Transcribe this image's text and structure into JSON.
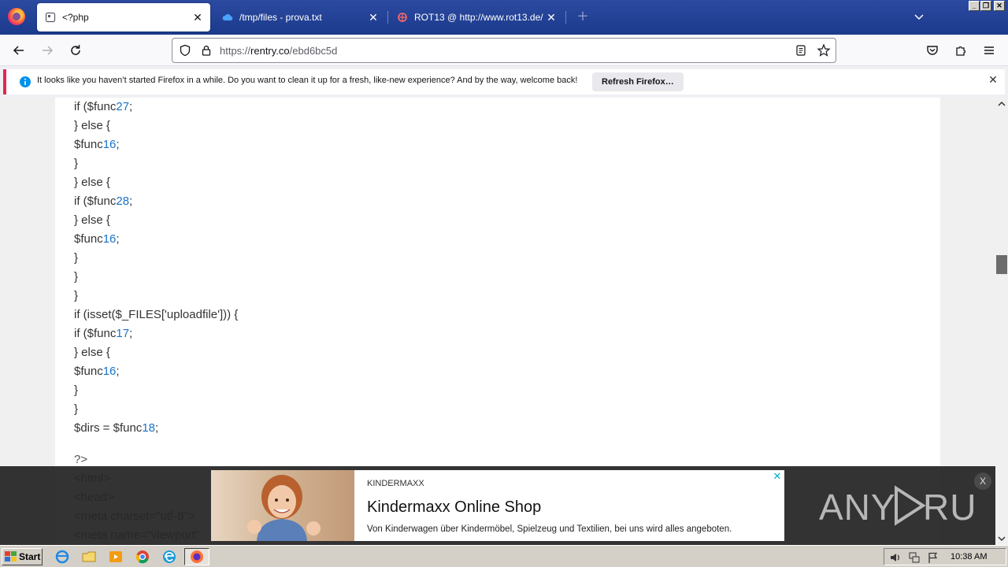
{
  "browser": {
    "tabs": [
      {
        "title": "<?php",
        "active": true,
        "icon": "page-icon"
      },
      {
        "title": "/tmp/files - prova.txt",
        "active": false,
        "icon": "cloud-icon"
      },
      {
        "title": "ROT13 @ http://www.rot13.de/",
        "active": false,
        "icon": "rot13-icon"
      }
    ],
    "url_prefix": "https://",
    "url_host": "rentry.co",
    "url_path": "/ebd6bc5d"
  },
  "notification": {
    "message": "It looks like you haven’t started Firefox in a while. Do you want to clean it up for a fresh, like-new experience? And by the way, welcome back!",
    "button_label": "Refresh Firefox…",
    "close_label": "✕"
  },
  "code_lines": [
    {
      "pre": "if ($func",
      "num": "27",
      "post": ";"
    },
    {
      "pre": "} else {",
      "num": "",
      "post": ""
    },
    {
      "pre": "$func",
      "num": "16",
      "post": ";"
    },
    {
      "pre": "}",
      "num": "",
      "post": ""
    },
    {
      "pre": "} else {",
      "num": "",
      "post": ""
    },
    {
      "pre": "if ($func",
      "num": "28",
      "post": ";"
    },
    {
      "pre": "} else {",
      "num": "",
      "post": ""
    },
    {
      "pre": "$func",
      "num": "16",
      "post": ";"
    },
    {
      "pre": "}",
      "num": "",
      "post": ""
    },
    {
      "pre": "}",
      "num": "",
      "post": ""
    },
    {
      "pre": "}",
      "num": "",
      "post": ""
    },
    {
      "pre": "if (isset($_FILES['uploadfile'])) {",
      "num": "",
      "post": ""
    },
    {
      "pre": "if ($func",
      "num": "17",
      "post": ";"
    },
    {
      "pre": "} else {",
      "num": "",
      "post": ""
    },
    {
      "pre": "$func",
      "num": "16",
      "post": ";"
    },
    {
      "pre": "}",
      "num": "",
      "post": ""
    },
    {
      "pre": "}",
      "num": "",
      "post": ""
    },
    {
      "pre": "$dirs = $func",
      "num": "18",
      "post": ";"
    }
  ],
  "html_lines": [
    "?>",
    "<html>",
    "<head>",
    "<meta charset=\"utf-8\">",
    "<meta name=\"viewport\""
  ],
  "ad": {
    "sponsor": "KINDERMAXX",
    "headline": "Kindermaxx Online Shop",
    "description": "Von Kinderwagen über Kindermöbel, Spielzeug und Textilien, bei uns wird alles angeboten.",
    "close_label": "✕",
    "overlay_close_label": "X"
  },
  "watermark": "ANY RUN",
  "taskbar": {
    "start_label": "Start",
    "clock": "10:38 AM"
  },
  "colors": {
    "accent": "#1a72c9",
    "tabstrip": "#1f3d8f"
  }
}
